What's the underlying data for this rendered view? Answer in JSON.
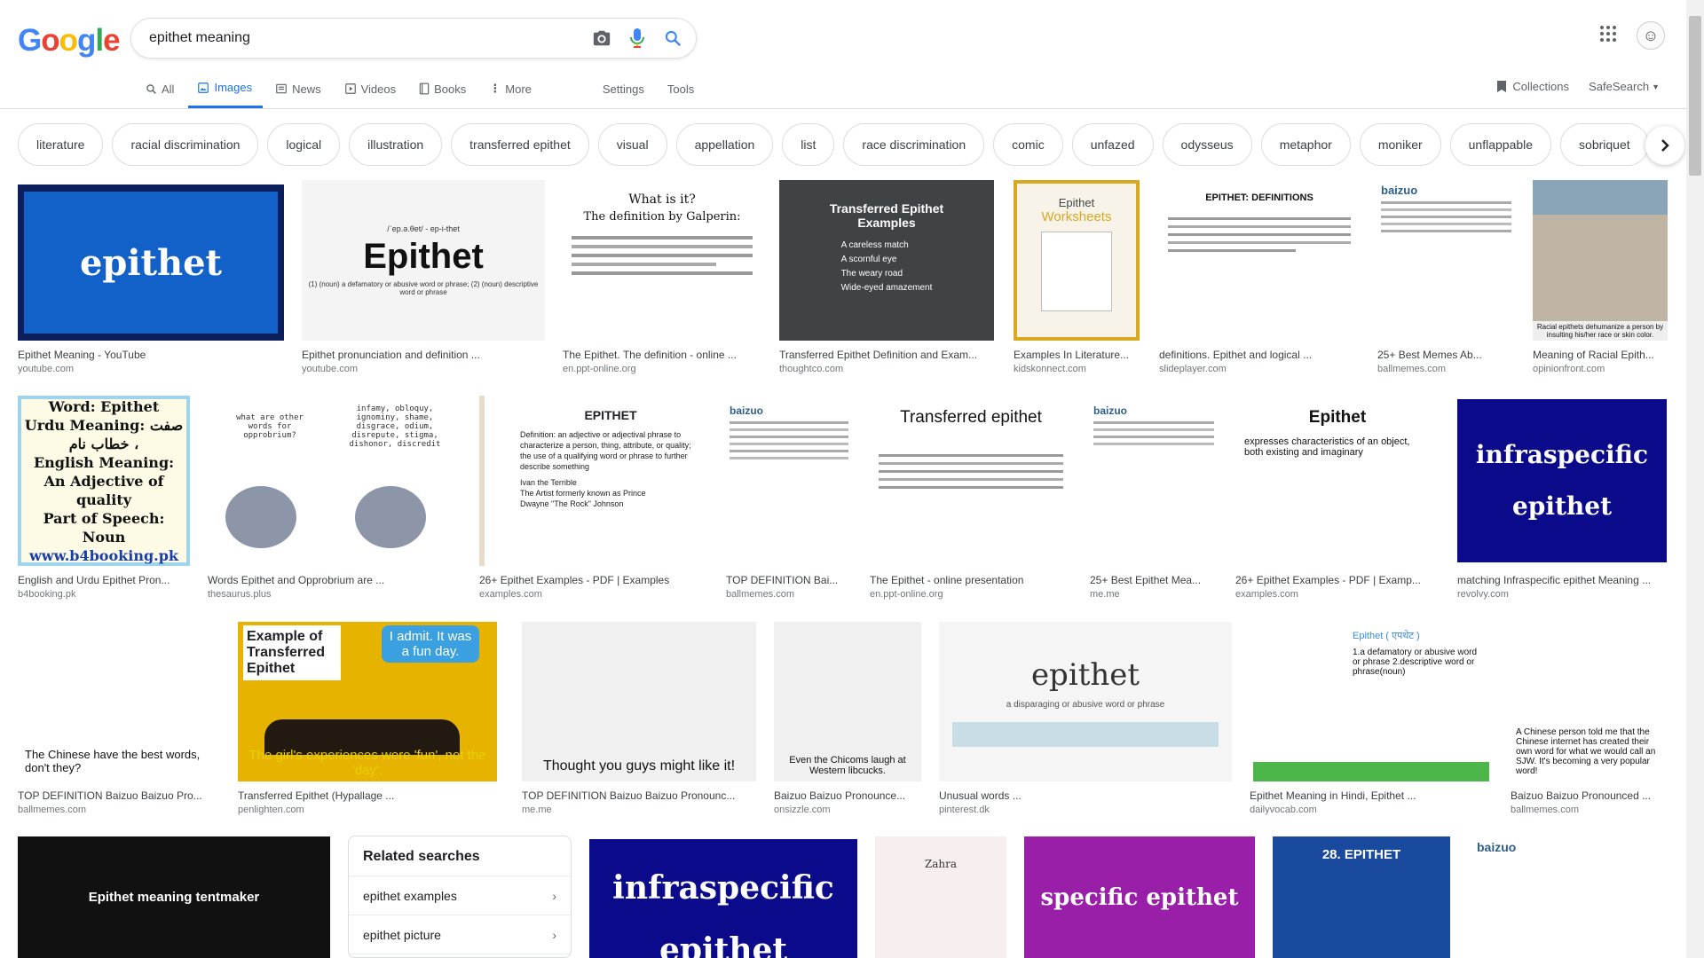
{
  "logo": "Google",
  "search": {
    "query": "epithet meaning"
  },
  "tabs": [
    {
      "label": "All",
      "icon": "search-icon"
    },
    {
      "label": "Images",
      "icon": "image-icon"
    },
    {
      "label": "News",
      "icon": "news-icon"
    },
    {
      "label": "Videos",
      "icon": "video-icon"
    },
    {
      "label": "Books",
      "icon": "book-icon"
    },
    {
      "label": "More",
      "icon": "more-vert-icon"
    }
  ],
  "tools": {
    "settings": "Settings",
    "tools": "Tools"
  },
  "collections": "Collections",
  "safesearch": "SafeSearch",
  "chips": [
    "literature",
    "racial discrimination",
    "logical",
    "illustration",
    "transferred epithet",
    "visual",
    "appellation",
    "list",
    "race discrimination",
    "comic",
    "unfazed",
    "odysseus",
    "metaphor",
    "moniker",
    "unflappable",
    "sobriquet"
  ],
  "results": [
    {
      "caption": "Epithet Meaning - YouTube",
      "source": "youtube.com",
      "thumb_text": "epithet"
    },
    {
      "caption": "Epithet pronunciation and definition ...",
      "source": "youtube.com",
      "thumb_text": "Epithet",
      "thumb_sub": "/ˈep.ə.θet/ - ep-i-thet",
      "thumb_def": "(1) (noun) a defamatory or abusive word or phrase; (2) (noun) descriptive word or phrase"
    },
    {
      "caption": "The Epithet. The definition - online ...",
      "source": "en.ppt-online.org",
      "thumb_text": "What is it?",
      "thumb_sub": "The definition by Galperin:"
    },
    {
      "caption": "Transferred Epithet Definition and Exam...",
      "source": "thoughtco.com",
      "thumb_text": "Transferred Epithet Examples",
      "thumb_list": [
        "A careless match",
        "A scornful eye",
        "The weary road",
        "Wide-eyed amazement"
      ]
    },
    {
      "caption": "Examples In Literature...",
      "source": "kidskonnect.com",
      "thumb_text": "Epithet",
      "thumb_sub": "Worksheets"
    },
    {
      "caption": "definitions. Epithet and logical ...",
      "source": "slideplayer.com",
      "thumb_text": "EPITHET: DEFINITIONS"
    },
    {
      "caption": "25+ Best Memes Ab...",
      "source": "ballmemes.com",
      "thumb_text": "baizuo"
    },
    {
      "caption": "Meaning of Racial Epith...",
      "source": "opinionfront.com",
      "thumb_text": "Racial epithets dehumanize a person by insulting his/her race or skin color."
    },
    {
      "caption": "English and Urdu Epithet Pron...",
      "source": "b4booking.pk",
      "thumb_lines": [
        "Word: Epithet",
        "Urdu Meaning: صفت ، خطاب نام",
        "English Meaning: An Adjective of quality",
        "Part of Speech: Noun",
        "www.b4booking.pk"
      ]
    },
    {
      "caption": "Words Epithet and Opprobrium are ...",
      "source": "thesaurus.plus",
      "thumb_text": "what are other words for opprobrium?",
      "thumb_sub": "infamy, obloquy, ignominy, shame, disgrace, odium, disrepute, stigma, dishonor, discredit"
    },
    {
      "caption": "26+ Epithet Examples - PDF | Examples",
      "source": "examples.com",
      "thumb_text": "EPITHET",
      "thumb_sub": "Definition: an adjective or adjectival phrase to characterize a person, thing, attribute, or quality; the use of a qualifying word or phrase to further describe something",
      "thumb_list": [
        "Ivan the Terrible",
        "The Artist formerly known as Prince",
        "Dwayne \"The Rock\" Johnson"
      ]
    },
    {
      "caption": "TOP DEFINITION Bai...",
      "source": "ballmemes.com",
      "thumb_text": "baizuo"
    },
    {
      "caption": "The Epithet - online presentation",
      "source": "en.ppt-online.org",
      "thumb_text": "Transferred epithet"
    },
    {
      "caption": "25+ Best Epithet Mea...",
      "source": "me.me",
      "thumb_text": "baizuo"
    },
    {
      "caption": "26+ Epithet Examples - PDF | Examp...",
      "source": "examples.com",
      "thumb_text": "Epithet",
      "thumb_sub": "expresses characteristics of an object, both existing and imaginary"
    },
    {
      "caption": "matching Infraspecific epithet Meaning ...",
      "source": "revolvy.com",
      "thumb_text": "infraspecific epithet"
    },
    {
      "caption": "TOP DEFINITION Baizuo Baizuo Pro...",
      "source": "ballmemes.com",
      "thumb_text": "The Chinese have the best words, don't they?"
    },
    {
      "caption": "Transferred Epithet (Hypallage ...",
      "source": "penlighten.com",
      "thumb_text": "Example of Transferred Epithet",
      "thumb_sub": "I admit. It was a fun day.",
      "thumb_def": "The girl's experiences were 'fun', not the 'day'."
    },
    {
      "caption": "TOP DEFINITION Baizuo Baizuo Pronounc...",
      "source": "me.me",
      "thumb_text": "Thought you guys might like it!"
    },
    {
      "caption": "Baizuo Baizuo Pronounce...",
      "source": "onsizzle.com",
      "thumb_text": "Even the Chicoms laugh at Western libcucks."
    },
    {
      "caption": "Unusual words ...",
      "source": "pinterest.dk",
      "thumb_text": "epithet",
      "thumb_sub": "a disparaging or abusive word or phrase"
    },
    {
      "caption": "Epithet Meaning in Hindi, Epithet ...",
      "source": "dailyvocab.com",
      "thumb_text": "Epithet ( एपथेट )",
      "thumb_sub": "1.a defamatory or abusive word or phrase 2.descriptive word or phrase(noun)"
    },
    {
      "caption": "Baizuo Baizuo Pronounced ...",
      "source": "ballmemes.com",
      "thumb_text": "A Chinese person told me that the Chinese internet has created their own word for what we would call an SJW. It's becoming a very popular word!"
    },
    {
      "thumb_text": "Epithet meaning tentmaker"
    },
    {
      "thumb_text": "infraspecific epithet"
    },
    {
      "thumb_text": "Zahra"
    },
    {
      "thumb_text": "specific epithet"
    },
    {
      "thumb_text": "28. EPITHET"
    },
    {
      "thumb_text": "baizuo"
    }
  ],
  "related": {
    "title": "Related searches",
    "items": [
      "epithet examples",
      "epithet picture"
    ]
  }
}
